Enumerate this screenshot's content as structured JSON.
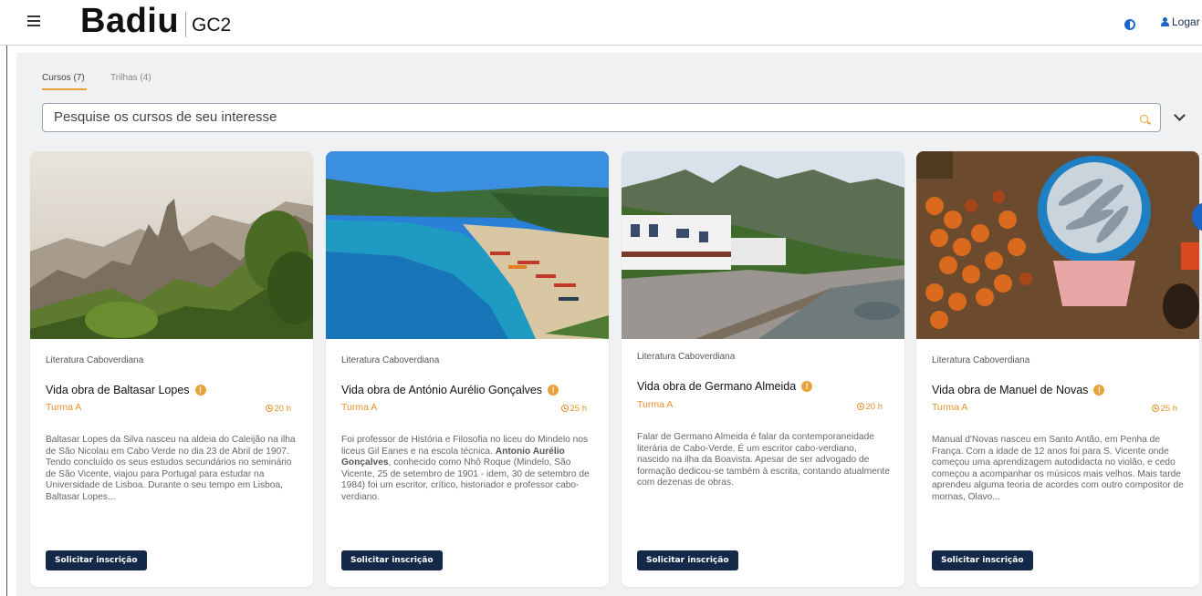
{
  "header": {
    "logo_main": "Badiu",
    "logo_sub": "GC2",
    "login_label": "Logar"
  },
  "tabs": [
    {
      "label": "Cursos (7)",
      "active": true
    },
    {
      "label": "Trilhas (4)",
      "active": false
    }
  ],
  "search": {
    "placeholder": "Pesquise os cursos de seu interesse"
  },
  "colors": {
    "accent": "#e8a33c",
    "navy_button": "#14294a",
    "brand_blue": "#1c64c6"
  },
  "cards": [
    {
      "image": "mountain-landscape",
      "category": "Literatura Caboverdiana",
      "title": "Vida obra de Baltasar Lopes",
      "turma": "Turma A",
      "hours": "20 h",
      "description": "Baltasar Lopes da Silva nasceu na aldeia do Caleijão na ilha de São Nicolau em Cabo Verde no dia 23 de Abril de 1907. Tendo concluído os seus estudos secundários no seminário de São Vicente, viajou para Portugal para estudar na Universidade de Lisboa. Durante o seu tempo em Lisboa, Baltasar Lopes...",
      "button": "Solicitar inscrição"
    },
    {
      "image": "beach-boats",
      "category": "Literatura Caboverdiana",
      "title": "Vida obra de António Aurélio Gonçalves",
      "turma": "Turma A",
      "hours": "25 h",
      "description_pre": "Foi professor de História e Filosofia no liceu do Mindelo nos liceus Gil Eanes e na escola técnica. ",
      "description_bold": "Antonio Aurélio Gonçalves",
      "description_post": ", conhecido como Nhô Roque (Mindelo, São Vicente, 25 de setembro de 1901 - idem, 30 de setembro de 1984) foi um escritor, crítico, historiador e professor cabo-verdiano.",
      "button": "Solicitar inscrição"
    },
    {
      "image": "coastal-village",
      "category": "Literatura Caboverdiana",
      "title": "Vida obra de Germano Almeida",
      "turma": "Turma A",
      "hours": "20 h",
      "description": "Falar de Germano Almeida é falar da contemporaneidade literária de Cabo-Verde. É um escritor cabo-verdiano, nascido na ilha da Boavista. Apesar de ser advogado de formação dedicou-se também à escrita, contando atualmente com dezenas de obras.",
      "button": "Solicitar inscrição"
    },
    {
      "image": "market-fish-basket",
      "category": "Literatura Caboverdiana",
      "title": "Vida obra de Manuel de Novas",
      "turma": "Turma A",
      "hours": "25 h",
      "description": "Manual d'Novas nasceu em Santo Antão, em Penha de França. Com a idade de 12 anos foi para S. Vicente onde começou uma aprendizagem autodidacta no violão, e cedo começou a acompanhar os músicos mais velhos. Mais tarde aprendeu alguma teoria de acordes com outro compositor de mornas, Olavo...",
      "button": "Solicitar inscrição"
    }
  ]
}
